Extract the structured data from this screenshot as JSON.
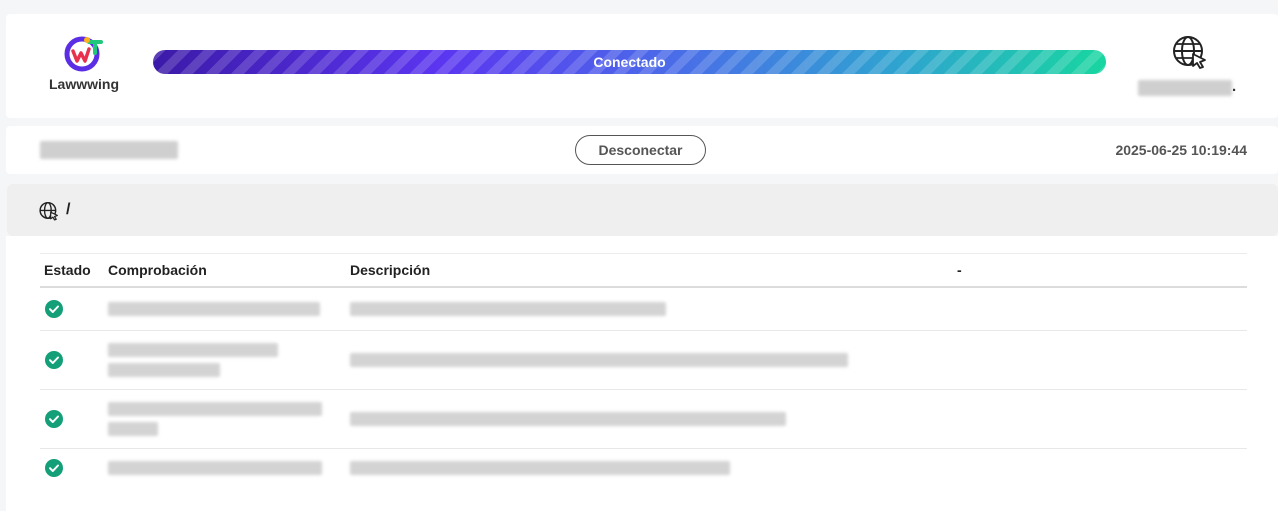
{
  "brand": {
    "name": "Lawwwing",
    "logo_icon": "lawwwing-logo-icon"
  },
  "status": {
    "label": "Conectado",
    "progress": 1.0
  },
  "header": {
    "language_icon": "globe-cursor-icon",
    "user_suffix": "."
  },
  "connection": {
    "disconnect_label": "Desconectar",
    "timestamp": "2025-06-25 10:19:44"
  },
  "path": {
    "icon": "globe-cursor-icon",
    "text": "/"
  },
  "table": {
    "headers": {
      "state": "Estado",
      "check": "Comprobación",
      "description": "Descripción",
      "extra": "-"
    },
    "rows": [
      {
        "status_icon": "check-circle-icon"
      },
      {
        "status_icon": "check-circle-icon"
      },
      {
        "status_icon": "check-circle-icon"
      },
      {
        "status_icon": "check-circle-icon"
      }
    ]
  },
  "colors": {
    "success": "#139f77",
    "accent_start": "#3c1aa8",
    "accent_end": "#18d6a0"
  }
}
